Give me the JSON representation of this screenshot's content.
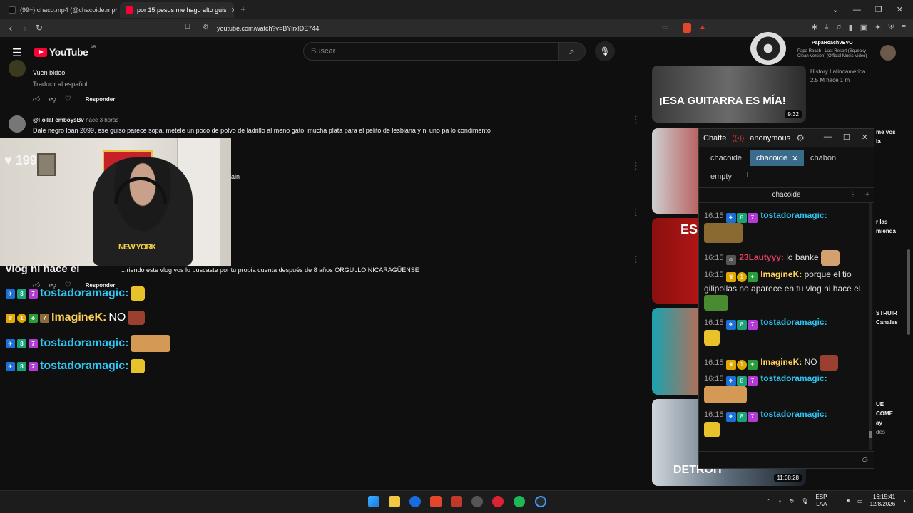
{
  "browser": {
    "tabs": [
      {
        "title": "(99+) chaco.mp4 (@chacoide.mp4) | T",
        "active": false
      },
      {
        "title": "por 15 pesos me hago alto guis",
        "active": true
      }
    ],
    "new_tab_icon": "plus-icon",
    "url": "youtube.com/watch?v=BYlrxlDE744"
  },
  "youtube": {
    "logo_text": "YouTube",
    "country_code": "AR",
    "search_placeholder": "Buscar",
    "miniplayer": {
      "channel": "PapaRoachVEVO",
      "line1": "Papa Roach - Last Resort (Squeaky",
      "line2": "Clean Version) (Official Music Video)"
    }
  },
  "comments": [
    {
      "author": "",
      "text": "Vuen bideo",
      "translate": "Traducir al español",
      "reply": "Responder"
    },
    {
      "author": "@FollaFemboysBv",
      "time": "hace 3 horas",
      "text": "Dale negro loan 2099, ese guiso parece sopa, metele un poco de polvo de ladrillo al meno gato, mucha plata para el pelito de lesbiana y ni uno pa lo condimento"
    },
    {
      "fragment": "ain"
    },
    {
      "text": "...riendo este vlog vos lo buscaste por tu propia cuenta después de 8 años  ORGULLO NICARAGÜENSE",
      "reply": "Responder"
    }
  ],
  "stream_overlay": {
    "viewer_count": "199",
    "fragment": "vlog ni hace el",
    "lines": [
      {
        "user": "tostadoramagic:",
        "style": "blue"
      },
      {
        "user": "ImagineK:",
        "text": "NO",
        "style": "yellow"
      },
      {
        "user": "tostadoramagic:",
        "style": "blue"
      },
      {
        "user": "tostadoramagic:",
        "style": "blue"
      }
    ]
  },
  "recommended": [
    {
      "thumb_text": "¡ESA GUITARRA ES MÍA!",
      "duration": "9:32",
      "channel": "History Latinoamérica",
      "meta": "2.5 M  hace 1 m"
    },
    {
      "title_frag": "me vos",
      "title_frag2": "ia"
    },
    {
      "thumb_text": "ES T",
      "title_frag": "r las",
      "title_frag2": "mienda"
    },
    {
      "title_frag": "STRUIR",
      "title_frag2": "Canales"
    },
    {
      "thumb_text": "DETROIT",
      "duration": "11:08:28",
      "title_frag": "UE",
      "title_frag2": "COME",
      "title_frag3": "ay",
      "title_frag4": "des"
    }
  ],
  "chat_window": {
    "title": "Chatte",
    "account": "anonymous",
    "tabs": [
      {
        "label": "chacoide",
        "active": false
      },
      {
        "label": "chacoide",
        "active": true
      },
      {
        "label": "chabon",
        "active": false
      },
      {
        "label": "empty",
        "active": false
      }
    ],
    "channel": "chacoide",
    "messages": [
      {
        "time": "16:15",
        "user": "tostadoramagic:",
        "text": ""
      },
      {
        "time": "16:15",
        "user": "23Lautyyy:",
        "text": "lo banke"
      },
      {
        "time": "16:15",
        "user": "ImagineK:",
        "text": "porque el tio gilipollas no aparece en tu vlog ni hace el"
      },
      {
        "time": "16:15",
        "user": "tostadoramagic:",
        "text": ""
      },
      {
        "time": "16:15",
        "user": "ImagineK:",
        "text": "NO"
      },
      {
        "time": "16:15",
        "user": "tostadoramagic:",
        "text": ""
      },
      {
        "time": "16:15",
        "user": "tostadoramagic:",
        "text": ""
      }
    ]
  },
  "taskbar": {
    "lang1": "ESP",
    "lang2": "LAA",
    "time": "16:15:41",
    "date": "12/8/2026"
  },
  "colors": {
    "youtube_red": "#ff0033",
    "chat_tab_active": "#3a6b8a",
    "name_blue": "#2ec4f1",
    "name_yellow": "#ffd257"
  }
}
